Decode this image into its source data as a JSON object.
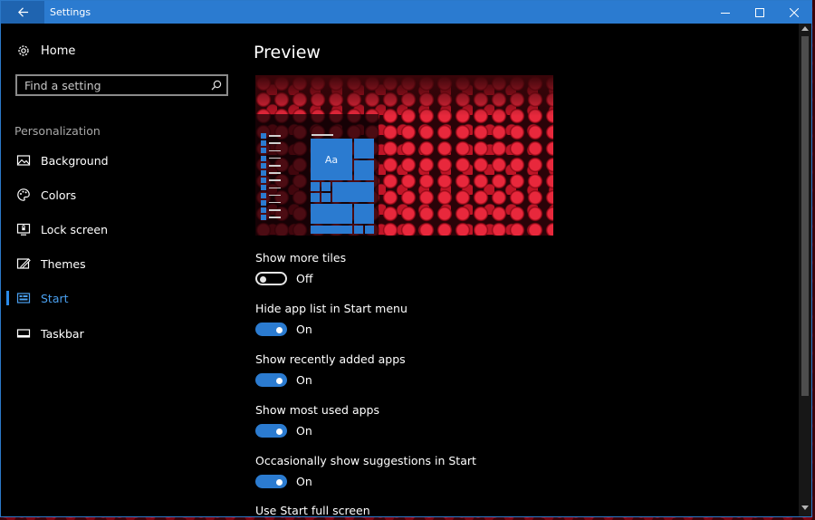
{
  "window": {
    "title": "Settings"
  },
  "sidebar": {
    "home_label": "Home",
    "search_placeholder": "Find a setting",
    "section_label": "Personalization",
    "items": [
      {
        "label": "Background",
        "icon": "picture-icon"
      },
      {
        "label": "Colors",
        "icon": "palette-icon"
      },
      {
        "label": "Lock screen",
        "icon": "lock-screen-icon"
      },
      {
        "label": "Themes",
        "icon": "themes-icon"
      },
      {
        "label": "Start",
        "icon": "start-icon",
        "active": true
      },
      {
        "label": "Taskbar",
        "icon": "taskbar-icon"
      }
    ]
  },
  "main": {
    "heading": "Preview",
    "preview": {
      "tile_label": "Aa"
    },
    "settings": [
      {
        "label": "Show more tiles",
        "state": "Off"
      },
      {
        "label": "Hide app list in Start menu",
        "state": "On"
      },
      {
        "label": "Show recently added apps",
        "state": "On"
      },
      {
        "label": "Show most used apps",
        "state": "On"
      },
      {
        "label": "Occasionally show suggestions in Start",
        "state": "On"
      },
      {
        "label": "Use Start full screen"
      }
    ]
  },
  "colors": {
    "accent": "#2b7bd0",
    "background": "#000000",
    "text": "#ffffff"
  }
}
